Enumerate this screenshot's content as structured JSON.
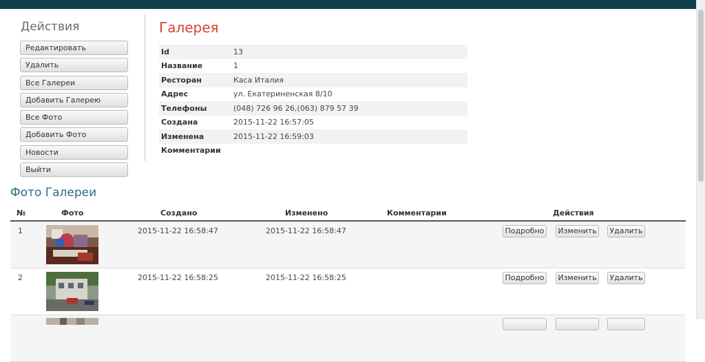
{
  "sidebar": {
    "title": "Действия",
    "buttons": [
      "Редактировать",
      "Удалить",
      "Все Галереи",
      "Добавить Галерею",
      "Все Фото",
      "Добавить Фото",
      "Новости",
      "Выйти"
    ]
  },
  "gallery": {
    "title": "Галерея",
    "fields": [
      {
        "label": "Id",
        "value": "13"
      },
      {
        "label": "Название",
        "value": "1"
      },
      {
        "label": "Ресторан",
        "value": "Каса Италия"
      },
      {
        "label": "Адрес",
        "value": "ул. Екатериненская 8/10"
      },
      {
        "label": "Телефоны",
        "value": "(048) 726 96 26,(063) 879 57 39"
      },
      {
        "label": "Создана",
        "value": "2015-11-22 16:57:05"
      },
      {
        "label": "Изменена",
        "value": "2015-11-22 16:59:03"
      },
      {
        "label": "Комментарии",
        "value": ""
      }
    ]
  },
  "photos": {
    "title": "Фото Галереи",
    "headers": {
      "num": "№",
      "photo": "Фото",
      "created": "Создано",
      "modified": "Изменено",
      "comments": "Комментарии",
      "actions": "Действия"
    },
    "actions": {
      "details": "Подробно",
      "edit": "Изменить",
      "delete": "Удалить"
    },
    "rows": [
      {
        "num": "1",
        "created": "2015-11-22 16:58:47",
        "modified": "2015-11-22 16:58:47",
        "comments": ""
      },
      {
        "num": "2",
        "created": "2015-11-22 16:58:25",
        "modified": "2015-11-22 16:58:25",
        "comments": ""
      }
    ]
  },
  "colors": {
    "topbar": "#0e3d4b",
    "gallery_title": "#d9432e",
    "photos_title": "#2f6a85"
  }
}
